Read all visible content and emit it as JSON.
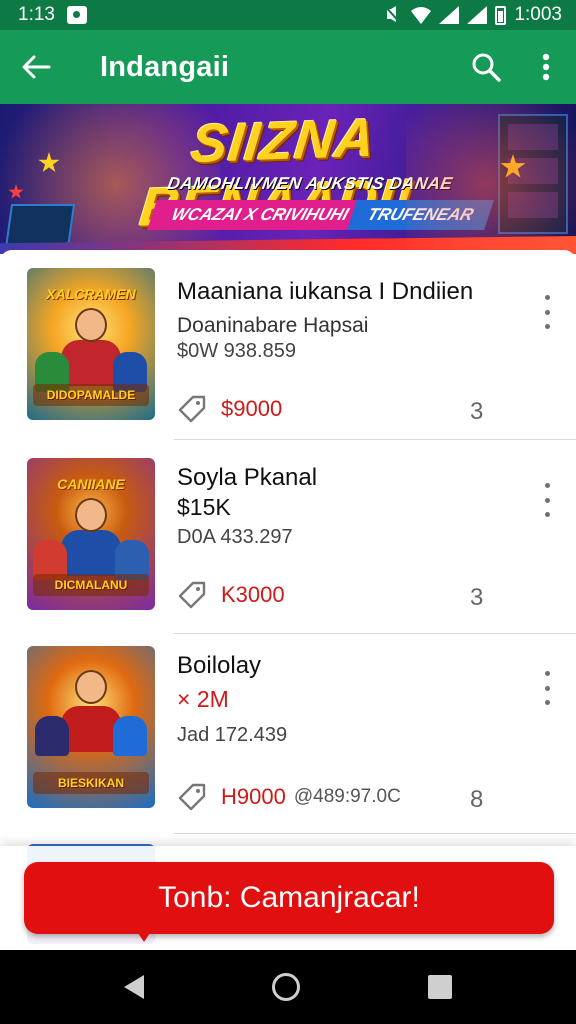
{
  "status_bar": {
    "time_left": "1:13",
    "time_right": "1:003"
  },
  "app_bar": {
    "title": "Indangaii",
    "back_icon": "arrow-left-icon",
    "search_icon": "search-icon",
    "more_icon": "more-vertical-icon"
  },
  "banner": {
    "headline": "SIIZNA BENAADI!",
    "subtitle": "DAMOHLIVMEN AUKSTIS DANAE",
    "tag_left": "WCAZAI X CRIVIHUHI",
    "tag_right": "TRUFENEAR"
  },
  "items": [
    {
      "title": "Maaniana iukansa I Dndiien",
      "line2": "Doaninabare Hapsai",
      "line3": "$0W 938.859",
      "price": "$9000",
      "extra": "",
      "count": "3",
      "thumb_logo": "XALCRAMEN",
      "thumb_logo2": "DIDOPAMALDE",
      "colors": {
        "bg_top": "#f5a623",
        "bg_bottom": "#1d6b8a",
        "accent": "#2a8c3a"
      }
    },
    {
      "title": "Soyla Pkanal",
      "line2": "$15K",
      "line3": "D0A 433.297",
      "price": "K3000",
      "extra": "",
      "count": "3",
      "thumb_logo": "CANIIANE",
      "thumb_logo2": "DICMALANU",
      "colors": {
        "bg_top": "#7b2aa5",
        "bg_bottom": "#c75b10",
        "accent": "#1f4ea8"
      }
    },
    {
      "title": "Boilolay",
      "line2": "× 2M",
      "line3": "Jad 172.439",
      "price": "H9000",
      "extra": "@489:97.0C",
      "count": "8",
      "thumb_logo": "",
      "thumb_logo2": "BIESKIKAN",
      "colors": {
        "bg_top": "#1a6dc2",
        "bg_bottom": "#e06a0f",
        "accent": "#c21d1d"
      }
    }
  ],
  "cta": {
    "label": "Tonb: Camanjracar!"
  },
  "nav_bar": {
    "back_icon": "nav-back-icon",
    "home_icon": "nav-home-icon",
    "recents_icon": "nav-recents-icon"
  }
}
